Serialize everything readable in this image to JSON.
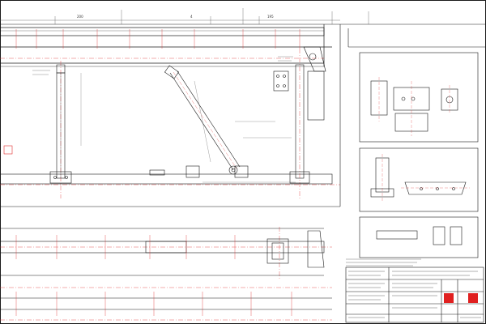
{
  "colors": {
    "ink": "#1a1a1a",
    "dim": "#555555",
    "center_line": "#e03030",
    "paper": "#ffffff",
    "accent_block": "#e02020",
    "hatch": "#888888"
  },
  "dimensions": {
    "d_1": "200",
    "d_2": "4",
    "d_3": "195"
  },
  "icons": [
    "truss-beam",
    "diagonal-brace",
    "column",
    "base-plate",
    "bracket-detail",
    "title-block"
  ]
}
